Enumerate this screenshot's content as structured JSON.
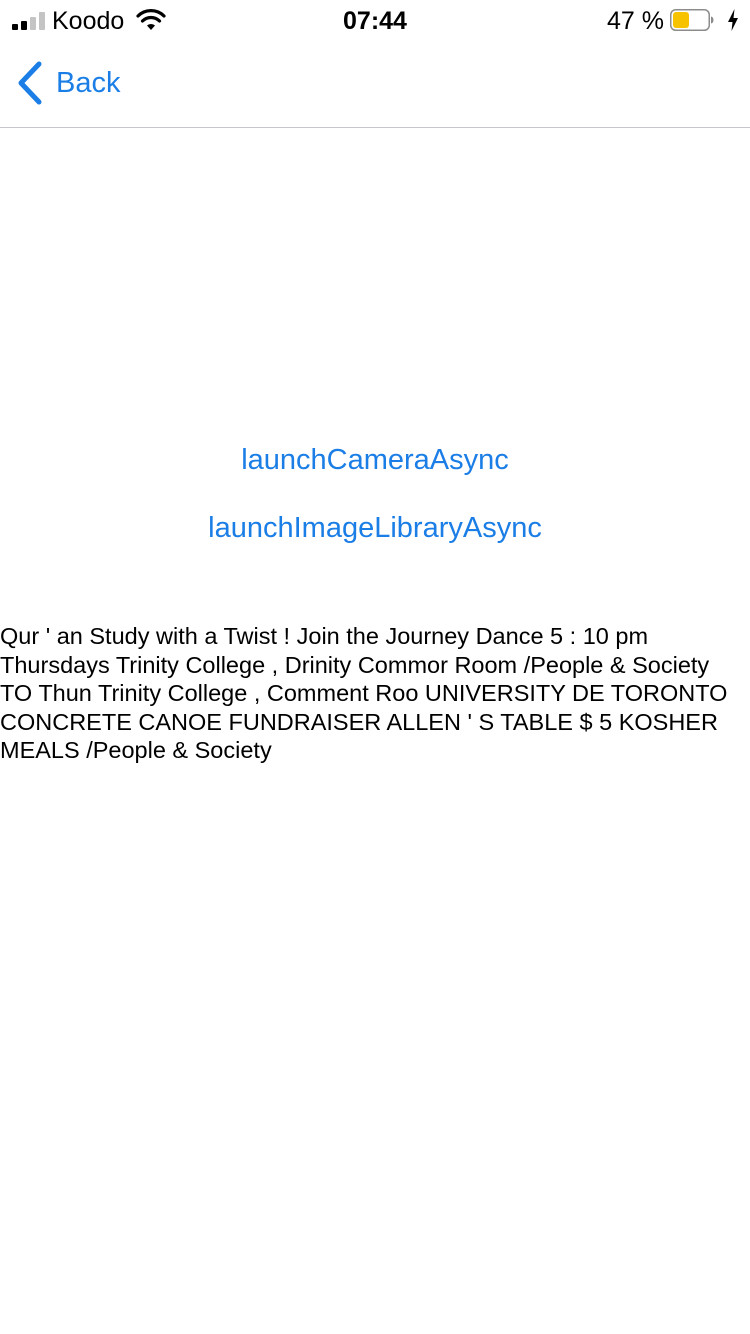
{
  "status_bar": {
    "carrier": "Koodo",
    "time": "07:44",
    "battery_percent": "47 %",
    "battery_level": 0.47,
    "signal_bars_filled": 2,
    "signal_bars_total": 4,
    "battery_color": "#f7c200",
    "charging": true
  },
  "nav": {
    "back_label": "Back",
    "accent_color": "#1a7ee6"
  },
  "actions": {
    "camera": "launchCameraAsync",
    "library": "launchImageLibraryAsync"
  },
  "result_text": "Qur ' an Study with a Twist ! Join the Journey Dance 5 : 10 pm Thursdays Trinity College , Drinity Commor Room /People & Society\nTO Thun Trinity College , Comment Roo UNIVERSITY DE TORONTO CONCRETE CANOE FUNDRAISER ALLEN ' S TABLE $ 5 KOSHER MEALS /People & Society"
}
